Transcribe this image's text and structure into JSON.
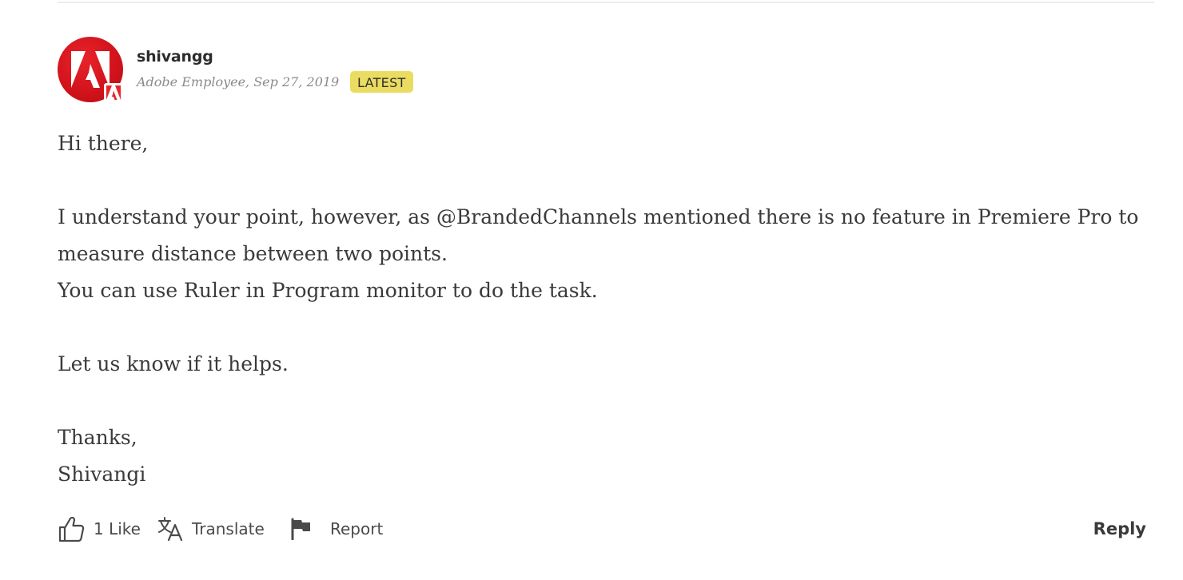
{
  "post": {
    "author": {
      "name": "shivangg",
      "meta": "Adobe Employee, Sep 27, 2019",
      "avatar_icon": "adobe-logo-icon",
      "badge_icon": "adobe-badge-icon"
    },
    "badge": "LATEST",
    "paragraphs": [
      "Hi there,",
      "",
      "I understand your point, however, as @BrandedChannels mentioned there is no feature in Premiere Pro to measure distance between two points.",
      "You can use Ruler in Program monitor to do the task.",
      "",
      "Let us know if it helps.",
      "",
      "Thanks,",
      "Shivangi"
    ]
  },
  "actions": {
    "like_label": "1 Like",
    "translate_label": "Translate",
    "report_label": "Report",
    "reply_label": "Reply"
  },
  "colors": {
    "brand_red": "#e8232a",
    "badge_yellow": "#e9dc61",
    "text": "#3a3a3a",
    "muted": "#8a8a8a"
  }
}
